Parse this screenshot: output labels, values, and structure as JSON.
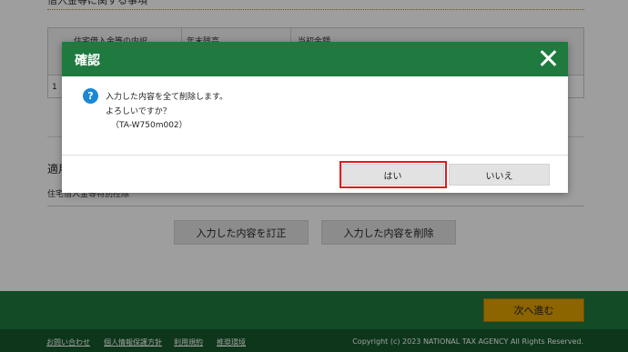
{
  "background": {
    "section_title": "借入金等に関する事項",
    "table_headers": [
      "住宅借入金等の内訳",
      "年末残高",
      "当初金額"
    ],
    "row_number": "1",
    "section_label": "適用",
    "sub_label": "住宅借入金等特別控除",
    "buttons": {
      "correct": "入力した内容を訂正",
      "delete": "入力した内容を削除"
    },
    "next": "次へ進む",
    "footer_links": [
      "お問い合わせ",
      "個人情報保護方針",
      "利用規約",
      "推奨環境"
    ],
    "copyright": "Copyright (c) 2023 NATIONAL TAX AGENCY All Rights Reserved."
  },
  "dialog": {
    "title": "確認",
    "icon": "question-icon",
    "message_line1": "入力した内容を全て削除します。",
    "message_line2": "よろしいですか？",
    "message_code": "（TA-W750m002）",
    "yes_label": "はい",
    "no_label": "いいえ"
  },
  "colors": {
    "header_green": "#1e7a3e",
    "footer_dark_green": "#15572a",
    "next_button": "#e2a200",
    "highlight": "#e0191b",
    "question_icon": "#1b88d6"
  }
}
